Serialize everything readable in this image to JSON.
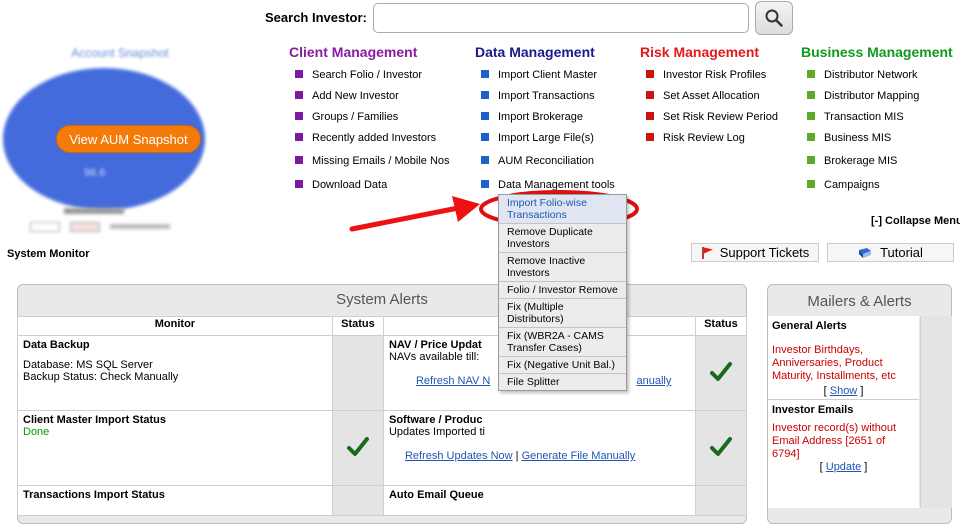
{
  "search": {
    "label": "Search Investor:",
    "placeholder": ""
  },
  "snapshot": {
    "title": "Account Snapshot",
    "pie_label": "96.6",
    "button_label": "View AUM Snapshot"
  },
  "columns": [
    {
      "title": "Client Management",
      "color": "#8a1aa0",
      "bullet": "#7c1aa0",
      "items": [
        "Search Folio / Investor",
        "Add New Investor",
        "Groups / Families",
        "Recently added Investors",
        "Missing Emails / Mobile Nos",
        "Download Data"
      ]
    },
    {
      "title": "Data Management",
      "color": "#1a1a8a",
      "bullet": "#1c62c8",
      "items": [
        "Import Client Master",
        "Import Transactions",
        "Import Brokerage",
        "Import Large File(s)",
        "AUM Reconciliation",
        "Data Management tools"
      ]
    },
    {
      "title": "Risk Management",
      "color": "#e21a1a",
      "bullet": "#cc1111",
      "items": [
        "Investor Risk Profiles",
        "Set Asset Allocation",
        "Set Risk Review Period",
        "Risk Review Log"
      ]
    },
    {
      "title": "Business Management",
      "color": "#0f9a1a",
      "bullet": "#5ca92c",
      "items": [
        "Distributor Network",
        "Distributor Mapping",
        "Transaction MIS",
        "Business MIS",
        "Brokerage MIS",
        "Campaigns"
      ]
    }
  ],
  "collapse_label": "[-] Collapse Menu",
  "dropdown": [
    "Import Folio-wise Transactions",
    "Remove Duplicate Investors",
    "Remove Inactive Investors",
    "Folio / Investor Remove",
    "Fix (Multiple Distributors)",
    "Fix (WBR2A - CAMS Transfer Cases)",
    "Fix (Negative Unit Bal.)",
    "File Splitter"
  ],
  "system_monitor": {
    "title": "System Monitor",
    "support_label": "Support Tickets",
    "tutorial_label": "Tutorial"
  },
  "alerts": {
    "title": "System Alerts",
    "headers": {
      "monitor": "Monitor",
      "status": "Status"
    },
    "rows": [
      {
        "title": "Data Backup",
        "lines": [
          "Database: MS SQL Server",
          "Backup Status: Check Manually"
        ]
      },
      {
        "title": "Client Master Import Status",
        "status_text": "Done"
      },
      {
        "title": "Transactions Import Status"
      }
    ],
    "right_rows": [
      {
        "title": "NAV / Price Updat",
        "line": "NAVs available till:",
        "link1": "Refresh NAV N",
        "link2": "anually"
      },
      {
        "title": "Software / Produc",
        "line": "Updates Imported ti",
        "link1": "Refresh Updates Now",
        "sep": "|",
        "link2": "Generate File Manually"
      },
      {
        "title": "Auto Email Queue"
      }
    ]
  },
  "mailers": {
    "title": "Mailers & Alerts",
    "general": {
      "title": "General Alerts",
      "text": "Investor Birthdays, Anniversaries, Product Maturity, Installments, etc",
      "link": "Show"
    },
    "emails": {
      "title": "Investor Emails",
      "text": "Investor record(s) without Email Address [2651 of 6794]",
      "link": "Update"
    }
  }
}
